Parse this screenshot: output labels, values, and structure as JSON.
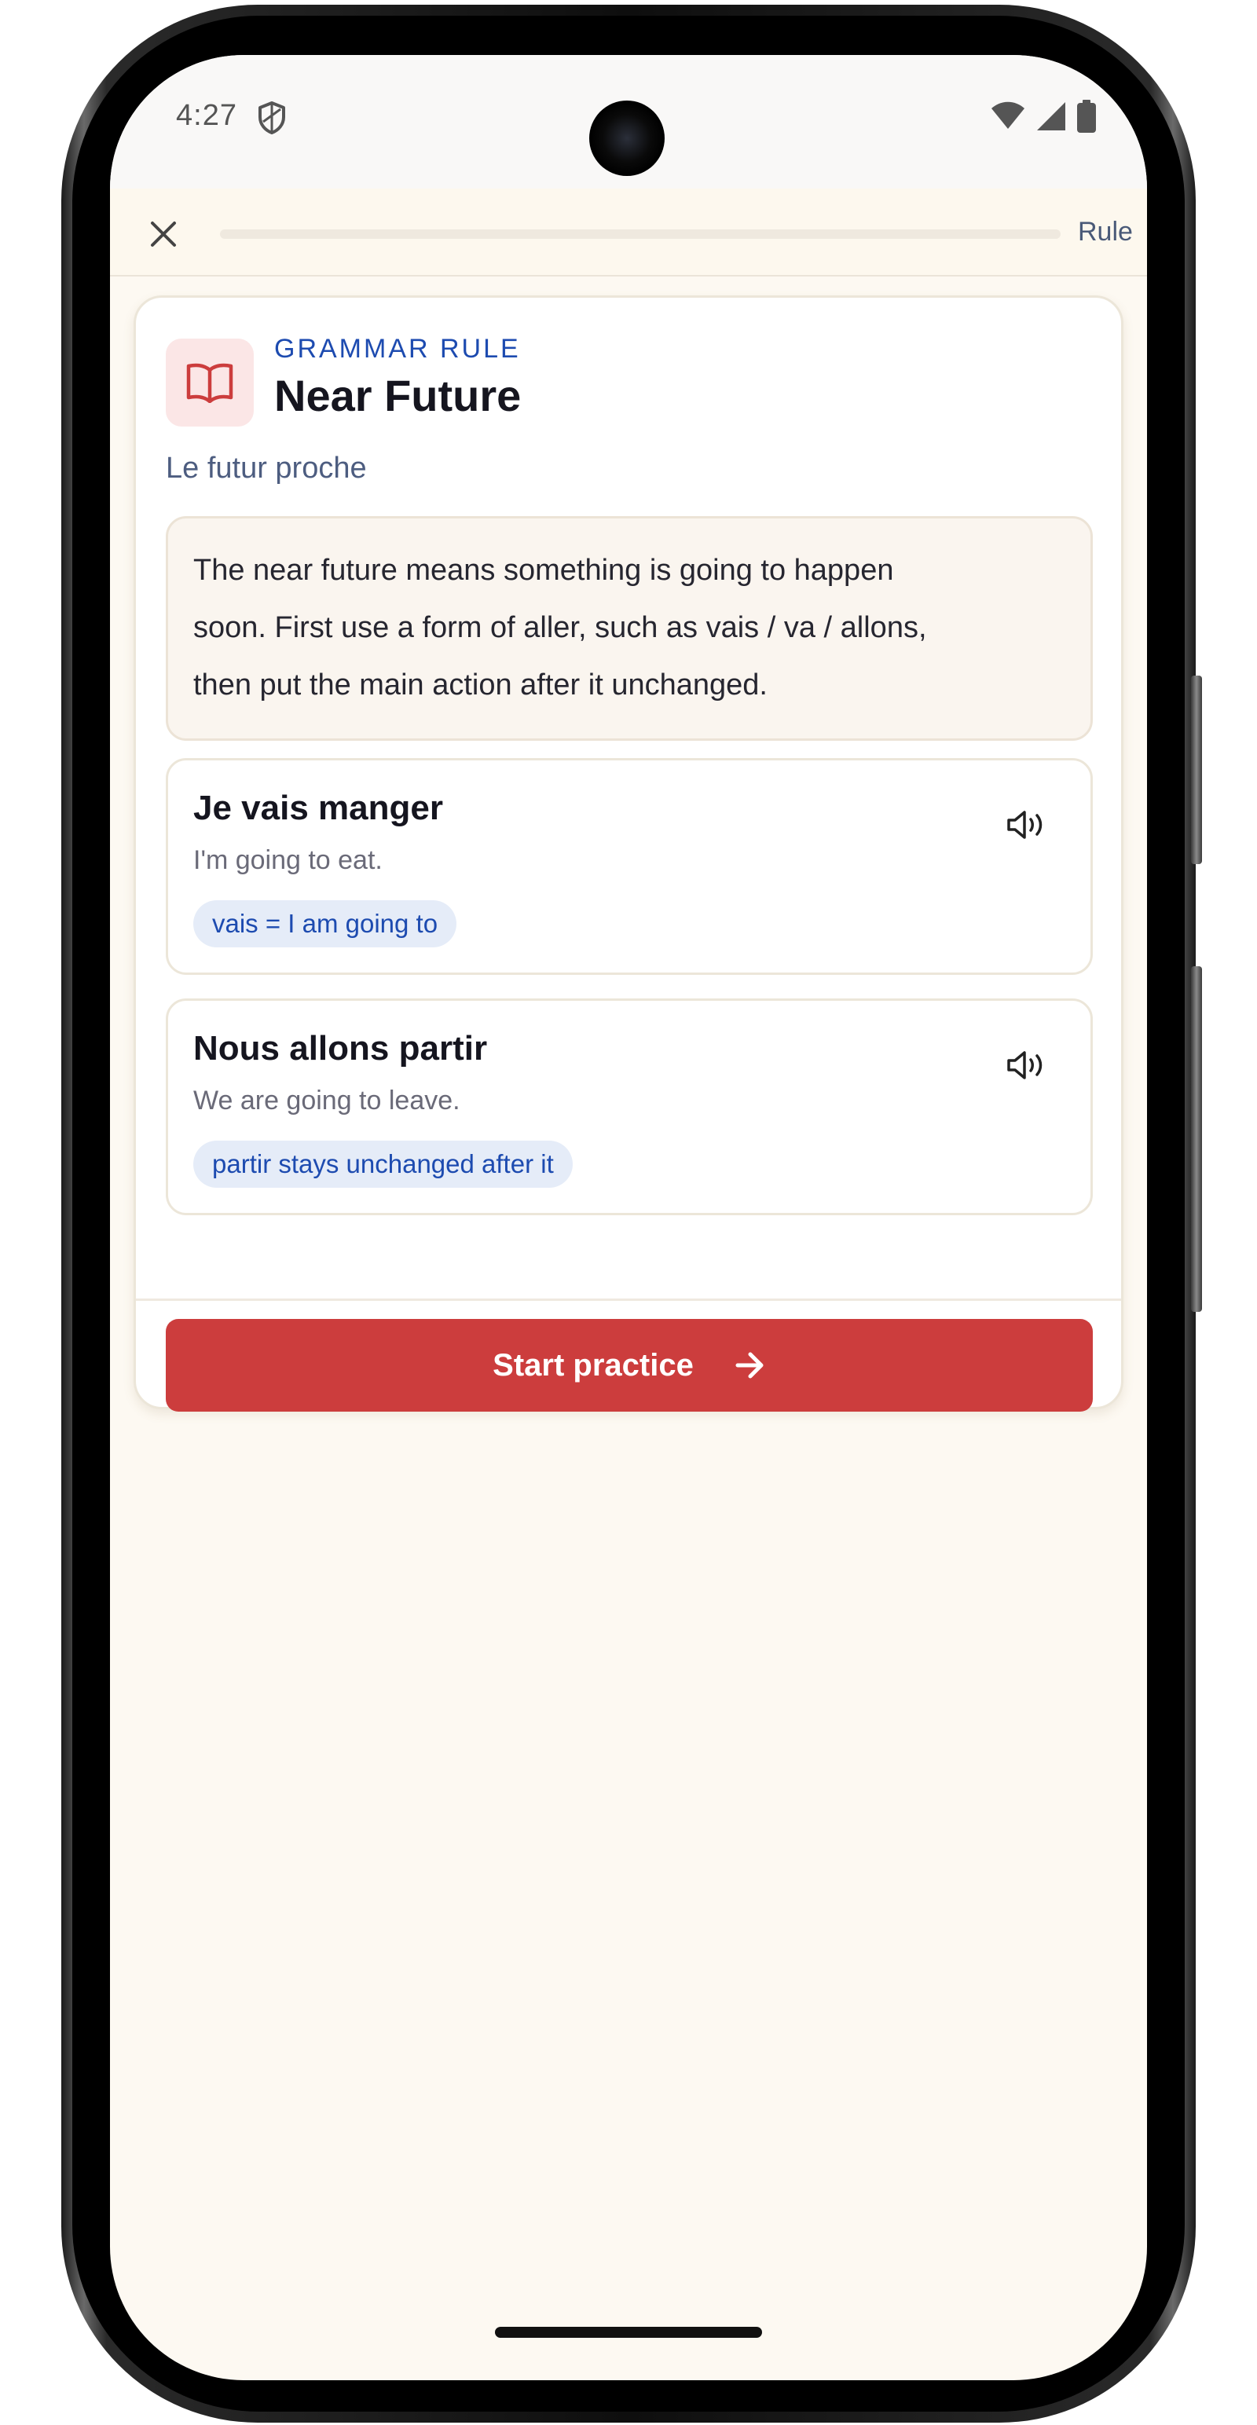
{
  "status_bar": {
    "time": "4:27",
    "icons": [
      "shield-icon",
      "wifi-icon",
      "cellular-signal-icon",
      "battery-icon"
    ]
  },
  "header": {
    "close_icon": "close-icon",
    "progress_percent": 0,
    "label": "Rule"
  },
  "rule": {
    "icon": "open-book-icon",
    "eyebrow": "GRAMMAR RULE",
    "title": "Near Future",
    "subtitle": "Le futur proche",
    "explanation_lines": [
      "The near future means something is going to happen",
      "soon. First use a form of aller, such as vais / va / allons,",
      "then put the main action after it unchanged."
    ]
  },
  "examples": [
    {
      "phrase": "Je vais manger",
      "translation": "I'm going to eat.",
      "note": "vais = I am going to",
      "audio_icon": "speaker-icon"
    },
    {
      "phrase": "Nous allons partir",
      "translation": "We are going to leave.",
      "note": "partir stays unchanged after it",
      "audio_icon": "speaker-icon"
    }
  ],
  "cta": {
    "label": "Start practice",
    "icon": "arrow-right-icon"
  },
  "colors": {
    "accent_red": "#cc3d3d",
    "accent_blue": "#1d4bb0",
    "background": "#fdf9f2",
    "chip_background": "#e5ecf8",
    "icon_tile": "#fbe6e6"
  }
}
